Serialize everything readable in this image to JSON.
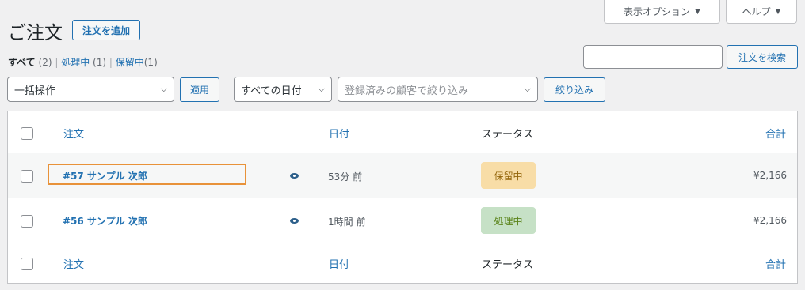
{
  "header": {
    "title": "ご注文",
    "add_order_label": "注文を追加"
  },
  "screen_meta": {
    "options_label": "表示オプション",
    "help_label": "ヘルプ"
  },
  "search": {
    "placeholder": "",
    "button_label": "注文を検索"
  },
  "subsubsub": [
    {
      "label": "すべて",
      "count": "(2)"
    },
    {
      "label": "処理中",
      "count": "(1)"
    },
    {
      "label": "保留中",
      "count": "(1)"
    }
  ],
  "filters": {
    "bulk_action": "一括操作",
    "apply_label": "適用",
    "date_filter": "すべての日付",
    "customer_placeholder": "登録済みの顧客で絞り込み",
    "filter_label": "絞り込み"
  },
  "table": {
    "columns": {
      "order": "注文",
      "date": "日付",
      "status": "ステータス",
      "total": "合計"
    },
    "rows": [
      {
        "order": "#57 サンプル 次郎",
        "date": "53分 前",
        "status": "保留中",
        "total": "¥2,166"
      },
      {
        "order": "#56 サンプル 次郎",
        "date": "1時間 前",
        "status": "処理中",
        "total": "¥2,166"
      }
    ]
  },
  "colors": {
    "accent": "#2271b1",
    "highlight_outline": "#e8923a",
    "on_hold_bg": "#f8dda7",
    "on_hold_text": "#94660c",
    "processing_bg": "#c6e1c6",
    "processing_text": "#5b841b"
  },
  "icons": {
    "preview": "eye-icon",
    "dropdown": "chevron-down-icon",
    "screen_toggle": "triangle-down-icon"
  }
}
